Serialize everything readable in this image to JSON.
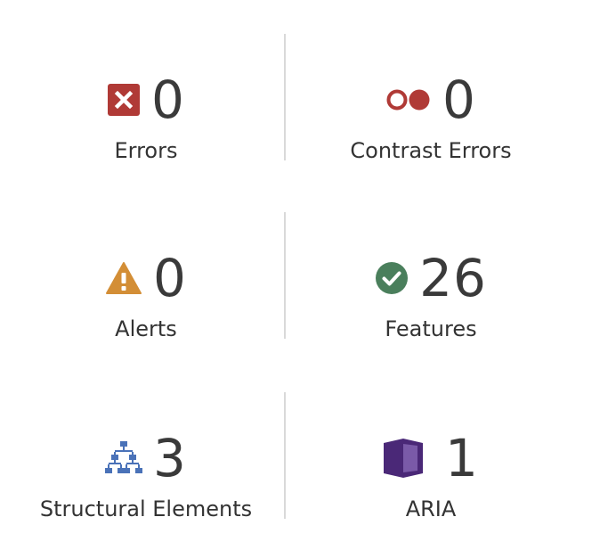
{
  "summary": {
    "errors": {
      "count": "0",
      "label": "Errors",
      "icon": "error-x-icon",
      "color": "#b03a36"
    },
    "contrast": {
      "count": "0",
      "label": "Contrast Errors",
      "icon": "contrast-circles-icon",
      "color": "#b03a36"
    },
    "alerts": {
      "count": "0",
      "label": "Alerts",
      "icon": "alert-triangle-icon",
      "color": "#d38e36"
    },
    "features": {
      "count": "26",
      "label": "Features",
      "icon": "checkmark-circle-icon",
      "color": "#4a7f5c"
    },
    "structure": {
      "count": "3",
      "label": "Structural Elements",
      "icon": "hierarchy-tree-icon",
      "color": "#4a72b8"
    },
    "aria": {
      "count": "1",
      "label": "ARIA",
      "icon": "aria-box-icon",
      "color": "#4a2877"
    }
  }
}
